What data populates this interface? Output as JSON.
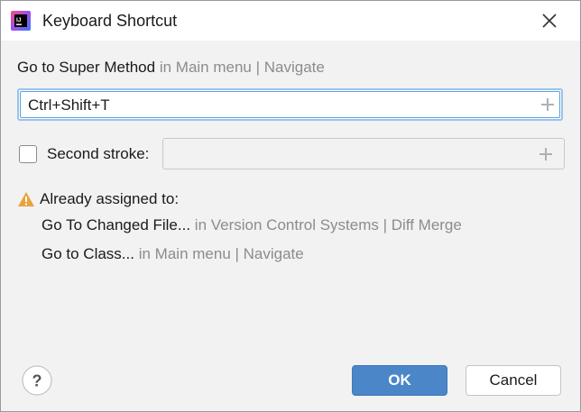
{
  "window": {
    "title": "Keyboard Shortcut",
    "app_icon": "intellij-idea-icon",
    "close_icon": "close-icon"
  },
  "action": {
    "name": "Go to Super Method",
    "location": "in Main menu | Navigate"
  },
  "first_stroke": {
    "value": "Ctrl+Shift+T",
    "add_icon": "plus-icon"
  },
  "second_stroke": {
    "checked": false,
    "label": "Second stroke:",
    "value": "",
    "add_icon": "plus-icon"
  },
  "conflicts": {
    "warning_icon": "warning-icon",
    "label": "Already assigned to:",
    "items": [
      {
        "name": "Go To Changed File...",
        "location": "in Version Control Systems | Diff  Merge"
      },
      {
        "name": "Go to Class...",
        "location": "in Main menu | Navigate"
      }
    ]
  },
  "footer": {
    "help_label": "?",
    "ok_label": "OK",
    "cancel_label": "Cancel"
  },
  "colors": {
    "accent": "#4a86c8",
    "focus_border": "#97c3ec",
    "warning": "#e8a33d",
    "muted_text": "#8c8c8c"
  }
}
